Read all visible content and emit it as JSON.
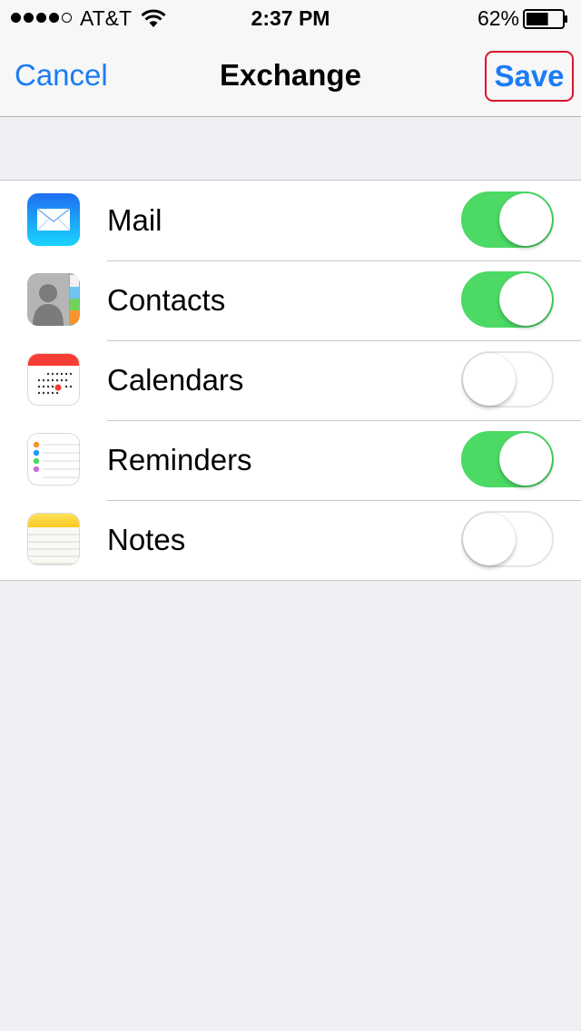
{
  "status_bar": {
    "signal_bars_filled": 4,
    "signal_bars_total": 5,
    "carrier": "AT&T",
    "time": "2:37 PM",
    "battery_percent": "62%",
    "battery_level": 0.62
  },
  "nav": {
    "cancel_label": "Cancel",
    "title": "Exchange",
    "save_label": "Save"
  },
  "colors": {
    "accent": "#1c7cf6",
    "toggle_on": "#4cd964",
    "highlight": "#d9152a"
  },
  "services": [
    {
      "label": "Mail",
      "icon": "mail-icon",
      "enabled": true
    },
    {
      "label": "Contacts",
      "icon": "contacts-icon",
      "enabled": true
    },
    {
      "label": "Calendars",
      "icon": "calendar-icon",
      "enabled": false
    },
    {
      "label": "Reminders",
      "icon": "reminders-icon",
      "enabled": true
    },
    {
      "label": "Notes",
      "icon": "notes-icon",
      "enabled": false
    }
  ]
}
